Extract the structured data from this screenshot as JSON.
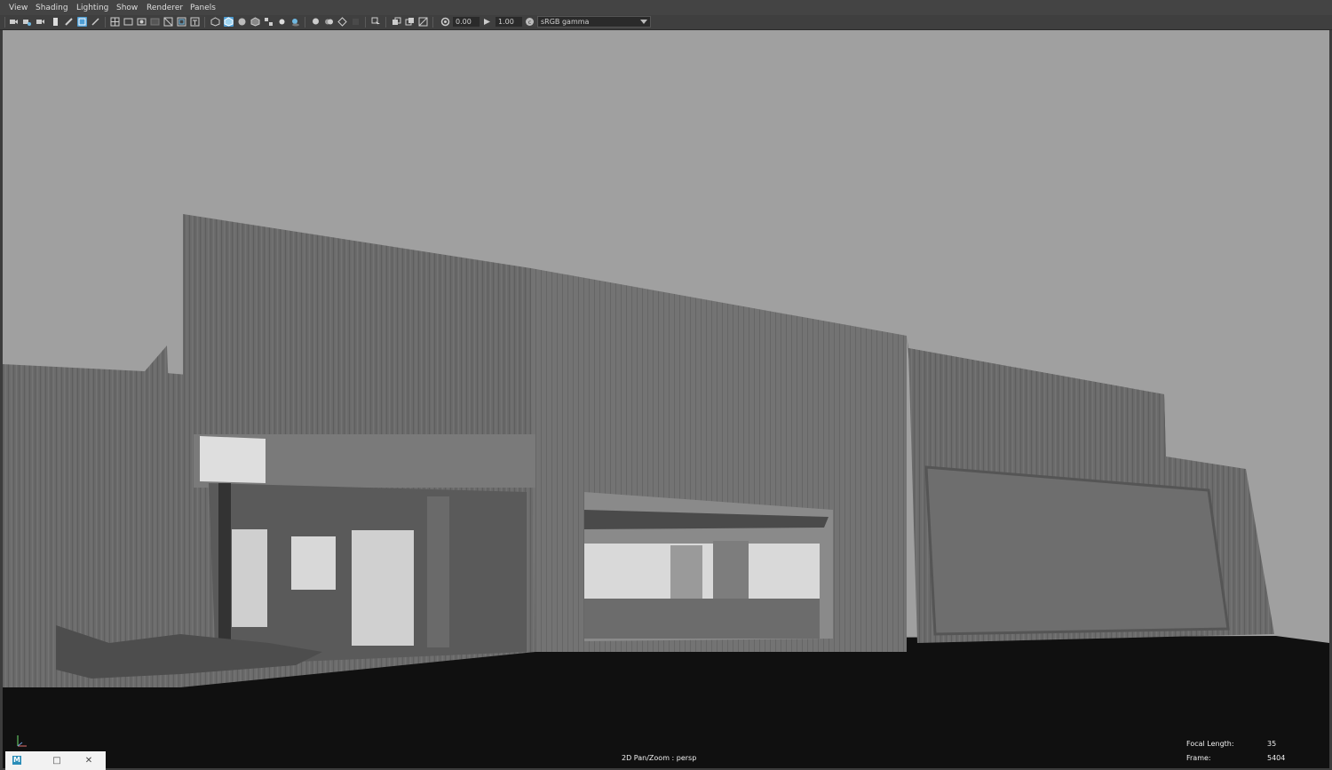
{
  "menu": {
    "items": [
      {
        "label": "View"
      },
      {
        "label": "Shading"
      },
      {
        "label": "Lighting"
      },
      {
        "label": "Show"
      },
      {
        "label": "Renderer"
      },
      {
        "label": "Panels"
      }
    ]
  },
  "toolbar": {
    "exposure_value": "0.00",
    "gamma_value": "1.00",
    "color_space": "sRGB gamma"
  },
  "viewport": {
    "camera_label": "2D Pan/Zoom : persp",
    "focal_length_label": "Focal Length:",
    "focal_length_value": "35",
    "frame_label": "Frame:",
    "frame_value": "5404",
    "background_color": "#a0a0a0",
    "ground_color": "#0f0f0f",
    "building_color": "#6a6a6a"
  },
  "taskbar": {
    "app_logo": "M",
    "minimize_icon": "□",
    "close_icon": "✕"
  }
}
